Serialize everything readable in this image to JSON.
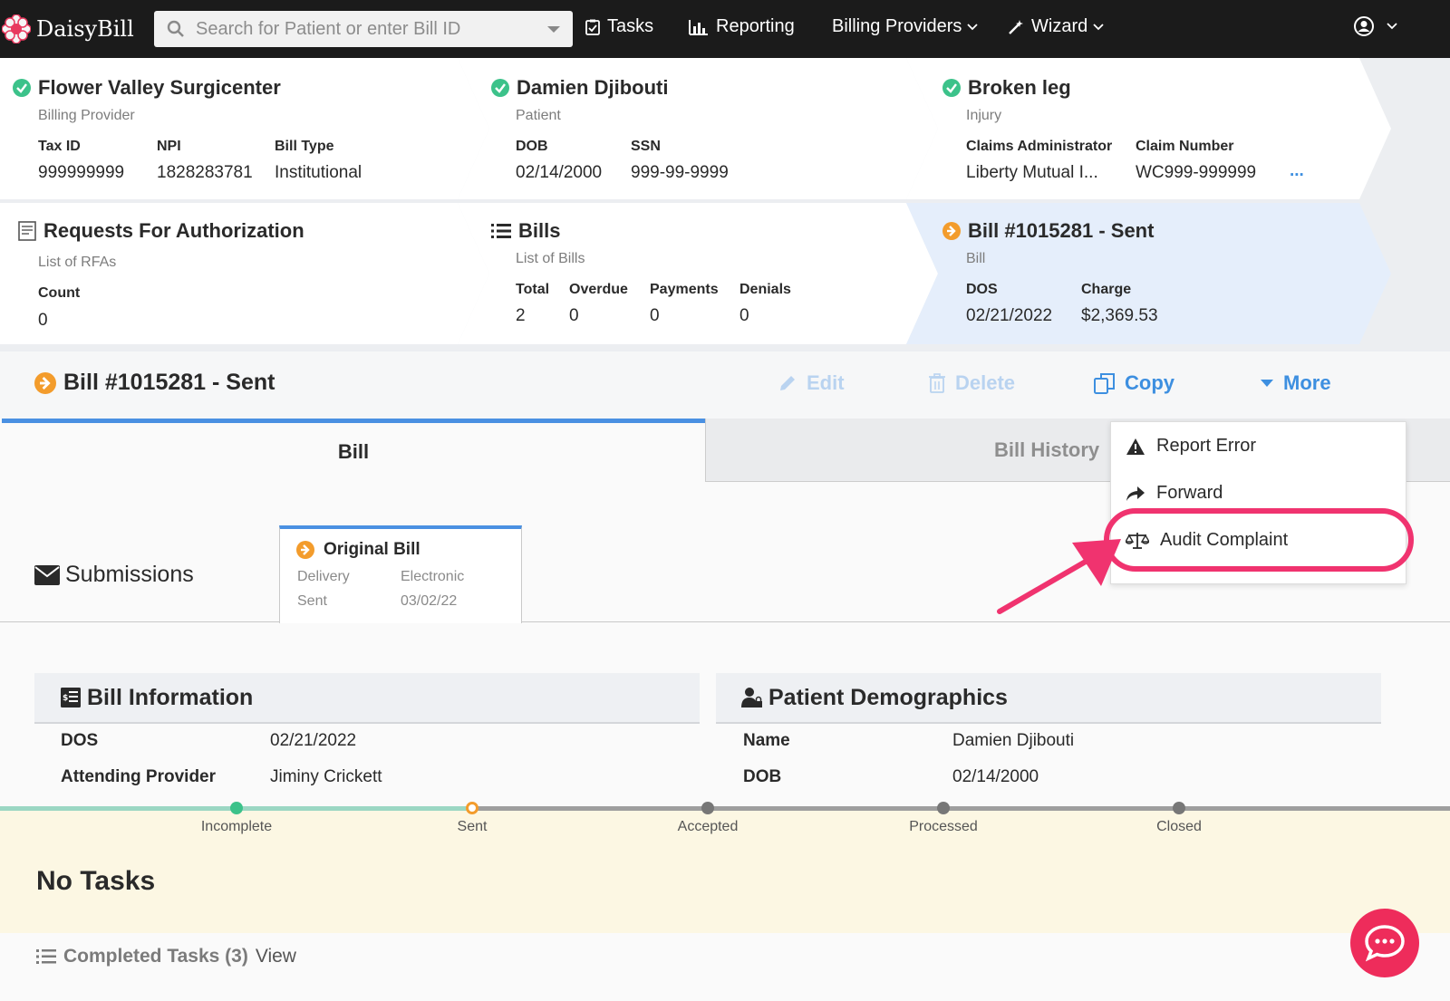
{
  "nav": {
    "logo_text": "DaisyBill",
    "search_placeholder": "Search for Patient or enter Bill ID",
    "tasks": "Tasks",
    "reporting": "Reporting",
    "billing_providers": "Billing Providers",
    "wizard": "Wizard"
  },
  "cards": {
    "provider": {
      "title": "Flower Valley Surgicenter",
      "subtitle": "Billing Provider",
      "tax_id_label": "Tax ID",
      "tax_id": "999999999",
      "npi_label": "NPI",
      "npi": "1828283781",
      "bill_type_label": "Bill Type",
      "bill_type": "Institutional"
    },
    "patient": {
      "title": "Damien Djibouti",
      "subtitle": "Patient",
      "dob_label": "DOB",
      "dob": "02/14/2000",
      "ssn_label": "SSN",
      "ssn": "999-99-9999"
    },
    "injury": {
      "title": "Broken leg",
      "subtitle": "Injury",
      "claims_admin_label": "Claims Administrator",
      "claims_admin": "Liberty Mutual I...",
      "claim_number_label": "Claim Number",
      "claim_number": "WC999-999999",
      "more": "..."
    },
    "rfa": {
      "title": "Requests For Authorization",
      "subtitle": "List of RFAs",
      "count_label": "Count",
      "count": "0"
    },
    "bills": {
      "title": "Bills",
      "subtitle": "List of Bills",
      "total_label": "Total",
      "total": "2",
      "overdue_label": "Overdue",
      "overdue": "0",
      "payments_label": "Payments",
      "payments": "0",
      "denials_label": "Denials",
      "denials": "0"
    },
    "bill": {
      "title": "Bill #1015281 - Sent",
      "subtitle": "Bill",
      "dos_label": "DOS",
      "dos": "02/21/2022",
      "charge_label": "Charge",
      "charge": "$2,369.53"
    }
  },
  "billbar": {
    "title": "Bill #1015281 - Sent",
    "edit": "Edit",
    "delete": "Delete",
    "copy": "Copy",
    "more": "More"
  },
  "tabs": {
    "bill": "Bill",
    "history": "Bill History"
  },
  "submissions": {
    "label": "Submissions",
    "original": {
      "title": "Original Bill",
      "delivery_label": "Delivery",
      "delivery": "Electronic",
      "sent_label": "Sent",
      "sent": "03/02/22"
    }
  },
  "bill_info": {
    "title": "Bill Information",
    "dos_label": "DOS",
    "dos": "02/21/2022",
    "attending_label": "Attending Provider",
    "attending": "Jiminy Crickett"
  },
  "demographics": {
    "title": "Patient Demographics",
    "name_label": "Name",
    "name": "Damien Djibouti",
    "dob_label": "DOB",
    "dob": "02/14/2000"
  },
  "progress": {
    "steps": [
      "Incomplete",
      "Sent",
      "Accepted",
      "Processed",
      "Closed"
    ]
  },
  "tasks": {
    "empty": "No Tasks",
    "completed_label": "Completed Tasks (3)",
    "view": "View"
  },
  "menu": {
    "report_error": "Report Error",
    "forward": "Forward",
    "audit_complaint": "Audit Complaint"
  },
  "colors": {
    "accent": "#4a90e2",
    "link": "#3d8fe0",
    "orange": "#f39c2c",
    "green": "#3cc28a",
    "highlight": "#f0336f"
  }
}
